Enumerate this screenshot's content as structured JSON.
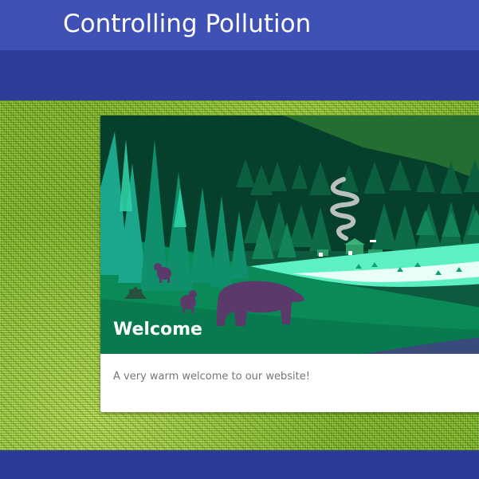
{
  "app": {
    "title": "Controlling Pollution",
    "colors": {
      "primary": "#3f51b5",
      "primary_dark": "#2f3d9a",
      "background_texture": "#7fb52a"
    }
  },
  "card": {
    "title": "Welcome",
    "text": "A very warm welcome to our website!",
    "image": "forest-bears-illustration"
  }
}
